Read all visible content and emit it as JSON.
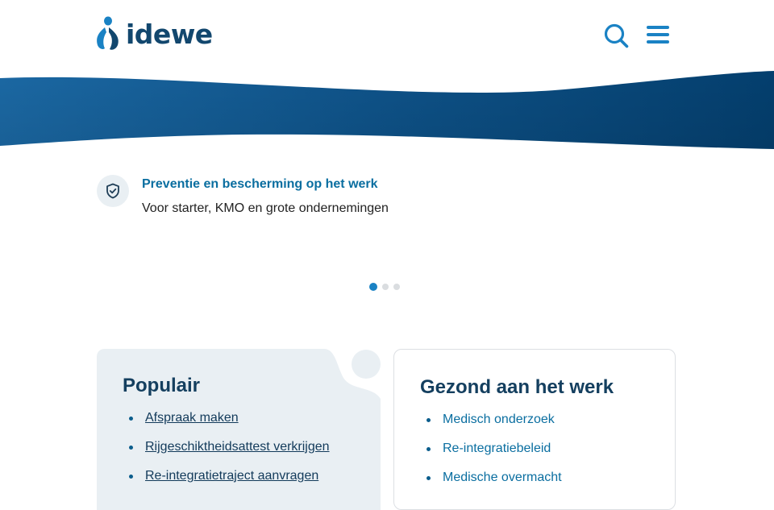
{
  "header": {
    "logo_text": "idewe",
    "search_icon": "search-icon",
    "menu_icon": "hamburger-menu-icon"
  },
  "colors": {
    "brand_dark": "#12476e",
    "brand_blue": "#1a82c4",
    "link_blue": "#0a6ea0",
    "card_tint": "#e9eff3"
  },
  "hero_slide": {
    "icon": "shield-check-icon",
    "title": "Preventie en bescherming op het werk",
    "subtitle": "Voor starter, KMO en grote ondernemingen"
  },
  "carousel": {
    "slide_count": 3,
    "active_index": 0
  },
  "popular_card": {
    "title": "Populair",
    "links": [
      "Afspraak maken",
      "Rijgeschiktheidsattest verkrijgen",
      "Re-integratietraject aanvragen"
    ]
  },
  "health_card": {
    "title": "Gezond aan het werk",
    "links": [
      "Medisch onderzoek",
      "Re-integratiebeleid",
      "Medische overmacht"
    ]
  }
}
